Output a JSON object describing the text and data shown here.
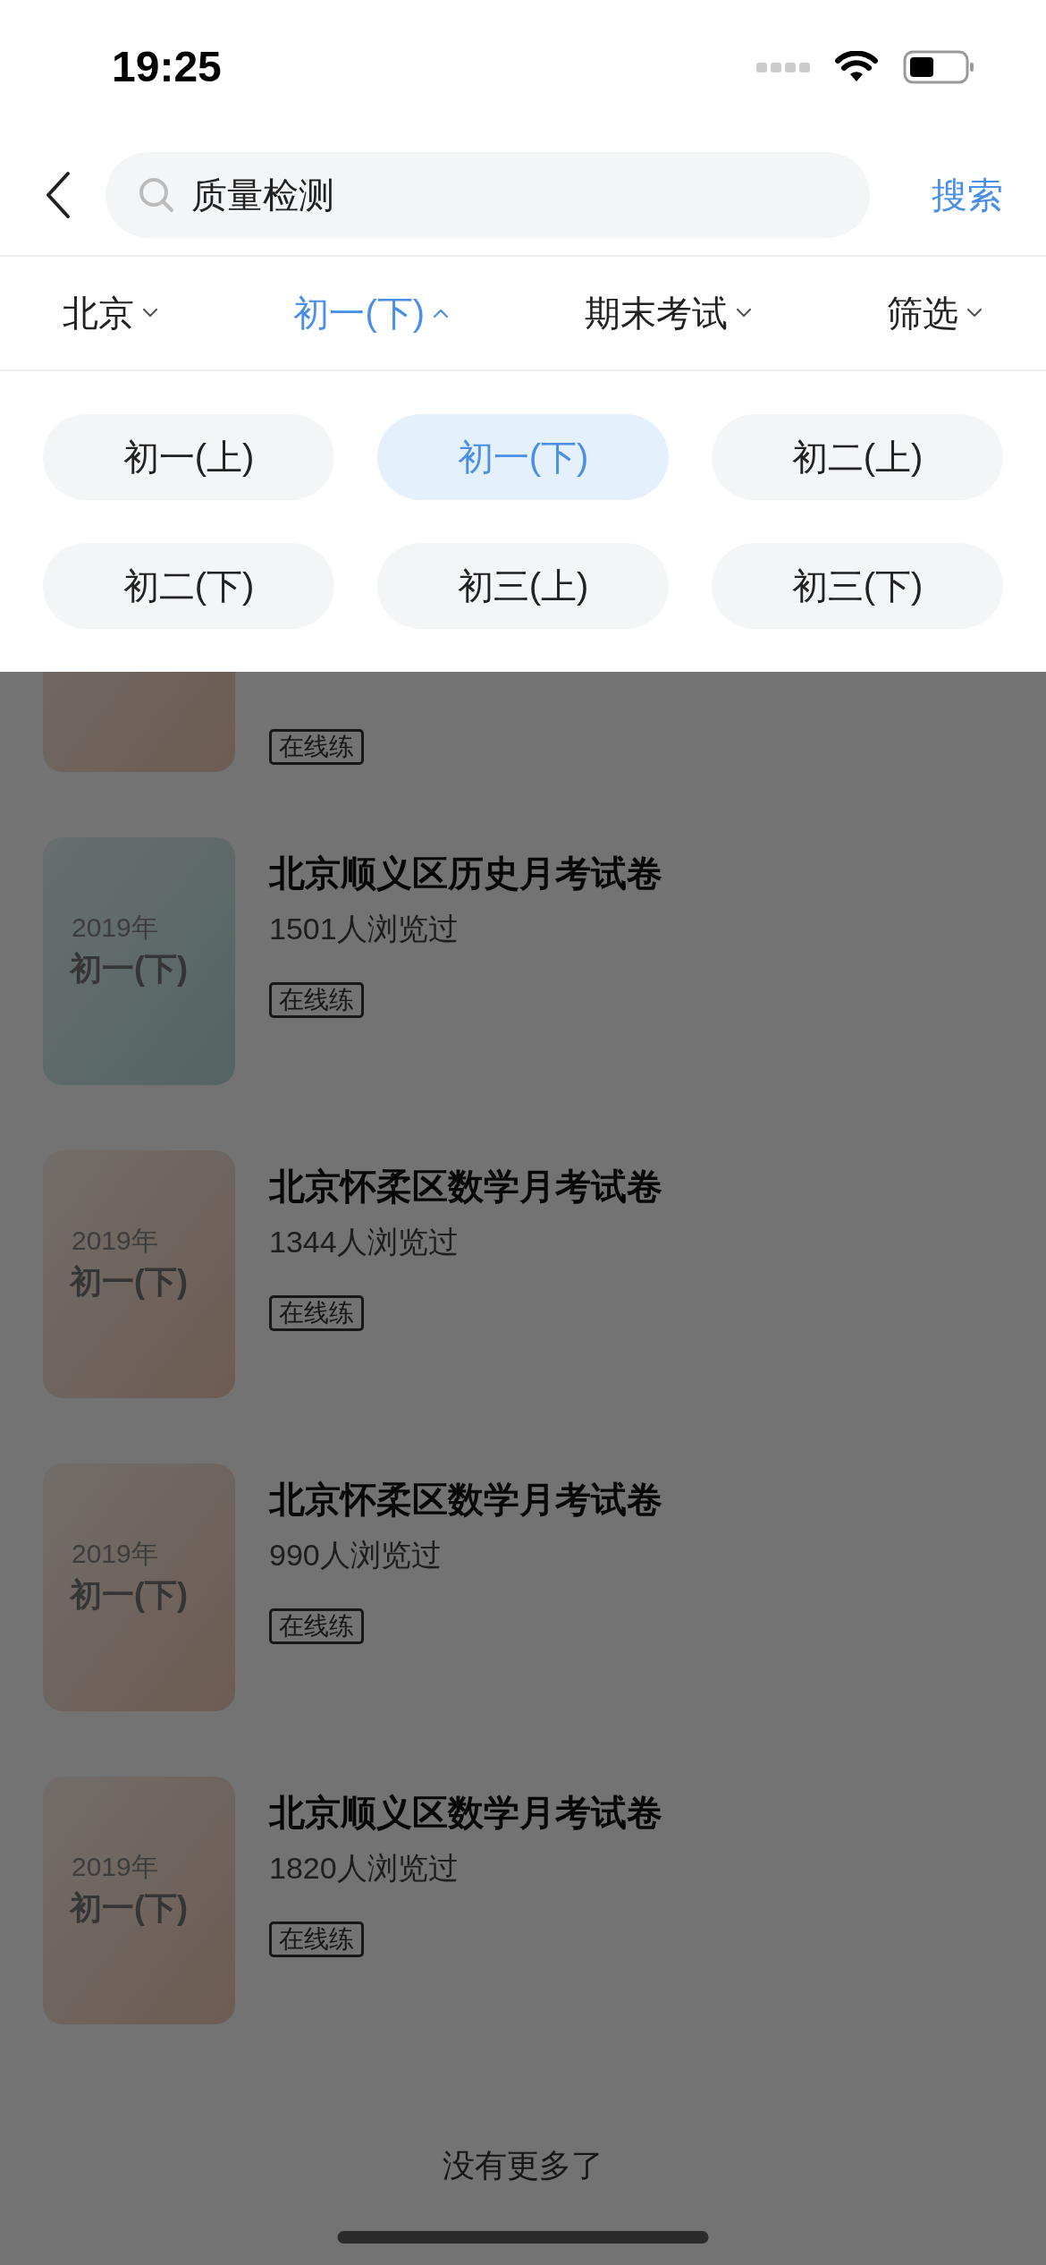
{
  "status_bar": {
    "time": "19:25"
  },
  "search": {
    "value": "质量检测",
    "button": "搜索"
  },
  "filters": [
    {
      "label": "北京",
      "selected": false
    },
    {
      "label": "初一(下)",
      "selected": true
    },
    {
      "label": "期末考试",
      "selected": false
    },
    {
      "label": "筛选",
      "selected": false
    }
  ],
  "grade_options": [
    {
      "label": "初一(上)",
      "selected": false
    },
    {
      "label": "初一(下)",
      "selected": true
    },
    {
      "label": "初二(上)",
      "selected": false
    },
    {
      "label": "初二(下)",
      "selected": false
    },
    {
      "label": "初三(上)",
      "selected": false
    },
    {
      "label": "初三(下)",
      "selected": false
    }
  ],
  "papers": [
    {
      "kind": "peach",
      "tag": "在线练"
    },
    {
      "kind": "mint",
      "year": "2019年",
      "grade": "初一(下)",
      "title": "北京顺义区历史月考试卷",
      "views": "1501人浏览过",
      "tag": "在线练"
    },
    {
      "kind": "peach",
      "year": "2019年",
      "grade": "初一(下)",
      "title": "北京怀柔区数学月考试卷",
      "views": "1344人浏览过",
      "tag": "在线练"
    },
    {
      "kind": "peach",
      "year": "2019年",
      "grade": "初一(下)",
      "title": "北京怀柔区数学月考试卷",
      "views": "990人浏览过",
      "tag": "在线练"
    },
    {
      "kind": "peach",
      "year": "2019年",
      "grade": "初一(下)",
      "title": "北京顺义区数学月考试卷",
      "views": "1820人浏览过",
      "tag": "在线练"
    }
  ],
  "footer": "没有更多了"
}
